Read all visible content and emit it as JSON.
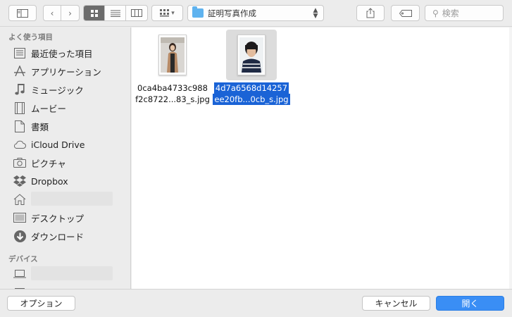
{
  "toolbar": {
    "sidebar_toggle_icon": "sidebar-icon",
    "back_icon": "chevron-left",
    "forward_icon": "chevron-right",
    "view_modes": [
      "icon-view",
      "list-view",
      "column-view"
    ],
    "arrange_icon": "grid-icon",
    "path_folder": "証明写真作成",
    "share_icon": "share-icon",
    "tag_icon": "tag-icon",
    "search_placeholder": "検索"
  },
  "sidebar": {
    "favorites": [
      {
        "label": "最近使った項目",
        "icon": "recents-icon"
      },
      {
        "label": "アプリケーション",
        "icon": "applications-icon"
      },
      {
        "label": "ミュージック",
        "icon": "music-icon"
      },
      {
        "label": "ムービー",
        "icon": "movies-icon"
      },
      {
        "label": "書類",
        "icon": "documents-icon"
      },
      {
        "label": "iCloud Drive",
        "icon": "cloud-icon"
      },
      {
        "label": "ピクチャ",
        "icon": "camera-icon"
      },
      {
        "label": "Dropbox",
        "icon": "dropbox-icon"
      },
      {
        "label": "",
        "icon": "home-icon"
      },
      {
        "label": "デスクトップ",
        "icon": "desktop-icon"
      },
      {
        "label": "ダウンロード",
        "icon": "download-icon"
      }
    ],
    "devices_title": "デバイス",
    "favorites_title": "よく使う項目"
  },
  "files": [
    {
      "line1": "0ca4ba4733c988",
      "line2": "f2c8722...83_s.jpg",
      "selected": false
    },
    {
      "line1": "4d7a6568d14257",
      "line2": "ee20fb...0cb_s.jpg",
      "selected": true
    }
  ],
  "footer": {
    "options_label": "オプション",
    "cancel_label": "キャンセル",
    "open_label": "開く"
  }
}
